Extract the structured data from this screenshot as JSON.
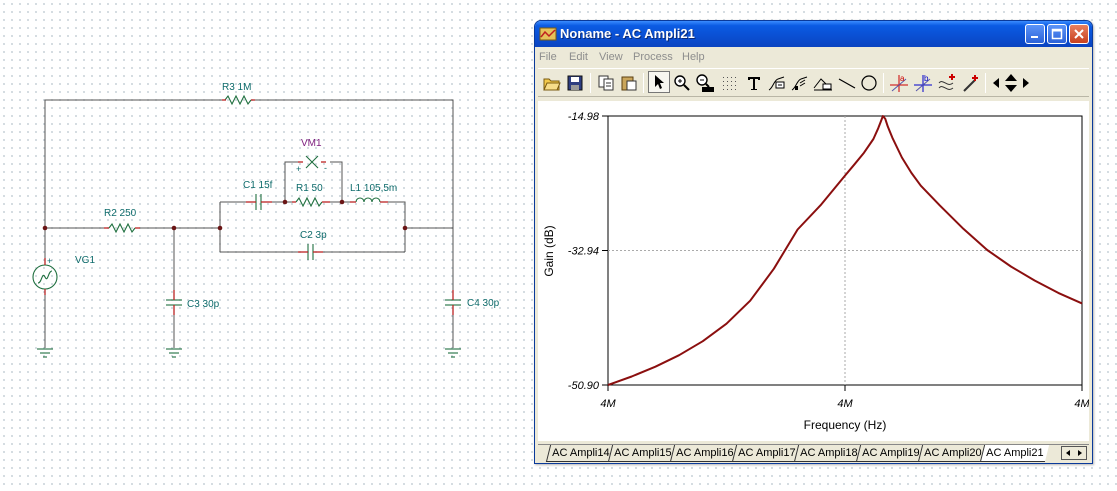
{
  "schematic": {
    "components": [
      {
        "id": "r3",
        "label": "R3 1M"
      },
      {
        "id": "vm1",
        "label": "VM1"
      },
      {
        "id": "c1",
        "label": "C1 15f"
      },
      {
        "id": "r1",
        "label": "R1 50"
      },
      {
        "id": "l1",
        "label": "L1 105,5m"
      },
      {
        "id": "r2",
        "label": "R2 250"
      },
      {
        "id": "c2",
        "label": "C2 3p"
      },
      {
        "id": "vg1",
        "label": "VG1"
      },
      {
        "id": "c3",
        "label": "C3 30p"
      },
      {
        "id": "c4",
        "label": "C4 30p"
      }
    ],
    "vm_plus": "+",
    "vm_minus": "-",
    "vg_plus": "+"
  },
  "window": {
    "title": "Noname - AC Ampli21",
    "menu": [
      "File",
      "Edit",
      "View",
      "Process",
      "Help"
    ],
    "toolbar_icons": [
      "open-icon",
      "save-icon",
      "copy-icon",
      "paste-icon",
      "pointer-icon",
      "zoom-in-icon",
      "zoom-100-icon",
      "grid-icon",
      "text-icon",
      "curve-label-icon",
      "curve-label-alt-icon",
      "axis-label-icon",
      "line-icon",
      "circle-icon",
      "cursor-a-icon",
      "cursor-b-icon",
      "add-curve-icon",
      "marker-icon",
      "arrow-left-icon",
      "arrow-updown-icon",
      "arrow-right-icon"
    ],
    "tabs": [
      "AC Ampli14",
      "AC Ampli15",
      "AC Ampli16",
      "AC Ampli17",
      "AC Ampli18",
      "AC Ampli19",
      "AC Ampli20",
      "AC Ampli21"
    ],
    "active_tab": "AC Ampli21"
  },
  "colors": {
    "curve": "#8b0f0f",
    "title_bar": "#0a4fd2",
    "schematic_part": "#1f6f3f",
    "schematic_label": "#0e6b6b"
  },
  "chart_data": {
    "type": "line",
    "xlabel": "Frequency (Hz)",
    "ylabel": "Gain (dB)",
    "x_tick_labels": [
      "4M",
      "4M",
      "4M"
    ],
    "y_tick_labels": [
      "-14.98",
      "-32.94",
      "-50.90"
    ],
    "ylim": [
      -50.9,
      -14.98
    ],
    "x": [
      0.0,
      0.05,
      0.1,
      0.15,
      0.2,
      0.25,
      0.3,
      0.35,
      0.4,
      0.45,
      0.5,
      0.52,
      0.54,
      0.56,
      0.57,
      0.575,
      0.58,
      0.585,
      0.59,
      0.6,
      0.62,
      0.64,
      0.66,
      0.7,
      0.75,
      0.8,
      0.85,
      0.9,
      0.95,
      1.0
    ],
    "series": [
      {
        "values": [
          -50.9,
          -49.77,
          -48.46,
          -46.92,
          -45.05,
          -42.72,
          -39.64,
          -35.37,
          -30.14,
          -26.78,
          -22.94,
          -21.43,
          -19.88,
          -18.05,
          -16.62,
          -15.84,
          -14.98,
          -15.37,
          -16.36,
          -17.89,
          -20.52,
          -22.58,
          -24.29,
          -26.92,
          -30.06,
          -32.87,
          -35.07,
          -36.94,
          -38.6,
          -40.01
        ]
      }
    ],
    "grid": true
  }
}
